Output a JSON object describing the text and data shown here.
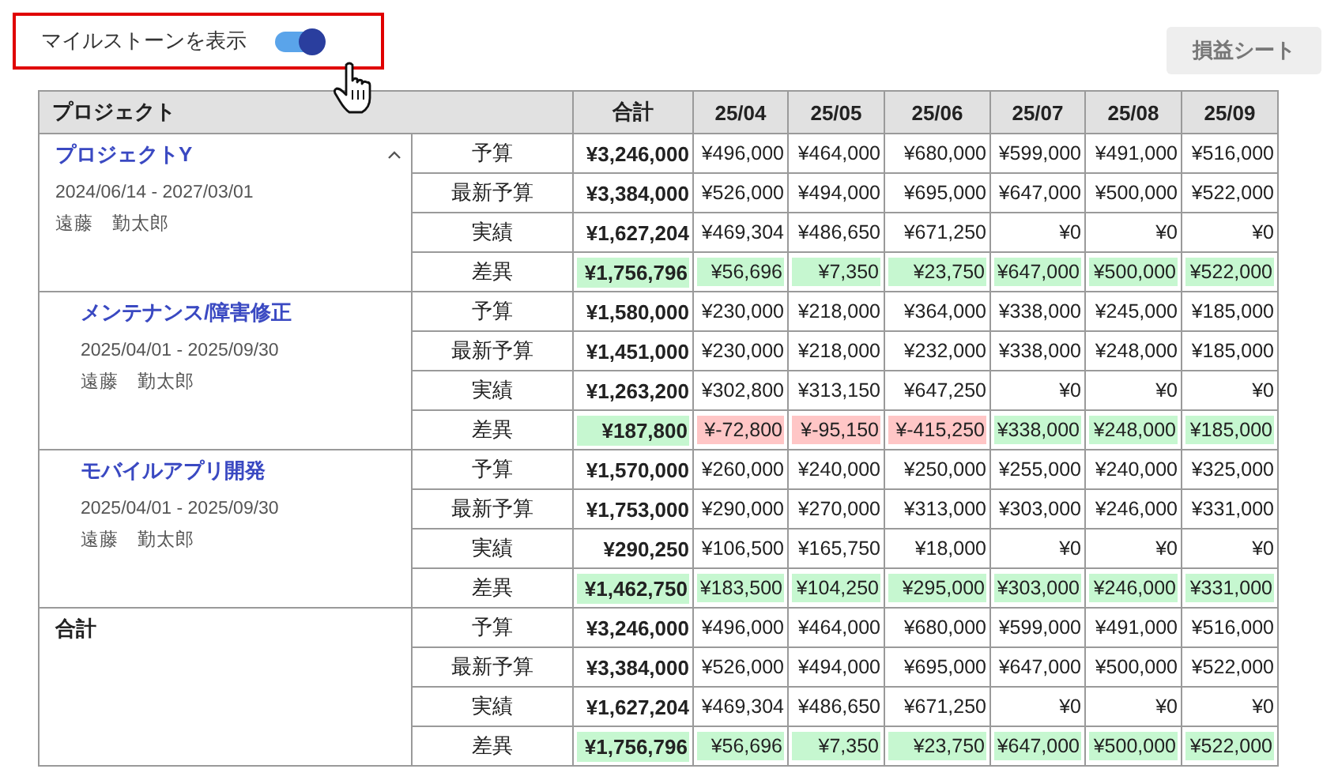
{
  "milestone_toggle": {
    "label": "マイルストーンを表示",
    "on": true
  },
  "pl_button": "損益シート",
  "table": {
    "columns": [
      "プロジェクト",
      "合計",
      "25/04",
      "25/05",
      "25/06",
      "25/07",
      "25/08",
      "25/09"
    ],
    "groups": [
      {
        "kind": "project",
        "name": "プロジェクトY",
        "expanded": true,
        "period": "2024/06/14 - 2027/03/01",
        "owner": "遠藤　勤太郎",
        "rows": [
          {
            "kind": "plain",
            "label": "予算",
            "total": "¥3,246,000",
            "values": [
              "¥496,000",
              "¥464,000",
              "¥680,000",
              "¥599,000",
              "¥491,000",
              "¥516,000"
            ]
          },
          {
            "kind": "plain",
            "label": "最新予算",
            "total": "¥3,384,000",
            "values": [
              "¥526,000",
              "¥494,000",
              "¥695,000",
              "¥647,000",
              "¥500,000",
              "¥522,000"
            ]
          },
          {
            "kind": "plain",
            "label": "実績",
            "total": "¥1,627,204",
            "values": [
              "¥469,304",
              "¥486,650",
              "¥671,250",
              "¥0",
              "¥0",
              "¥0"
            ]
          },
          {
            "kind": "variance",
            "label": "差異",
            "total": {
              "text": "¥1,756,796",
              "negative": false
            },
            "values": [
              {
                "text": "¥56,696",
                "negative": false
              },
              {
                "text": "¥7,350",
                "negative": false
              },
              {
                "text": "¥23,750",
                "negative": false
              },
              {
                "text": "¥647,000",
                "negative": false
              },
              {
                "text": "¥500,000",
                "negative": false
              },
              {
                "text": "¥522,000",
                "negative": false
              }
            ]
          }
        ]
      },
      {
        "kind": "subproject",
        "name": "メンテナンス/障害修正",
        "period": "2025/04/01 - 2025/09/30",
        "owner": "遠藤　勤太郎",
        "rows": [
          {
            "kind": "plain",
            "label": "予算",
            "total": "¥1,580,000",
            "values": [
              "¥230,000",
              "¥218,000",
              "¥364,000",
              "¥338,000",
              "¥245,000",
              "¥185,000"
            ]
          },
          {
            "kind": "plain",
            "label": "最新予算",
            "total": "¥1,451,000",
            "values": [
              "¥230,000",
              "¥218,000",
              "¥232,000",
              "¥338,000",
              "¥248,000",
              "¥185,000"
            ]
          },
          {
            "kind": "plain",
            "label": "実績",
            "total": "¥1,263,200",
            "values": [
              "¥302,800",
              "¥313,150",
              "¥647,250",
              "¥0",
              "¥0",
              "¥0"
            ]
          },
          {
            "kind": "variance",
            "label": "差異",
            "total": {
              "text": "¥187,800",
              "negative": false
            },
            "values": [
              {
                "text": "¥-72,800",
                "negative": true
              },
              {
                "text": "¥-95,150",
                "negative": true
              },
              {
                "text": "¥-415,250",
                "negative": true
              },
              {
                "text": "¥338,000",
                "negative": false
              },
              {
                "text": "¥248,000",
                "negative": false
              },
              {
                "text": "¥185,000",
                "negative": false
              }
            ]
          }
        ]
      },
      {
        "kind": "subproject",
        "name": "モバイルアプリ開発",
        "period": "2025/04/01 - 2025/09/30",
        "owner": "遠藤　勤太郎",
        "rows": [
          {
            "kind": "plain",
            "label": "予算",
            "total": "¥1,570,000",
            "values": [
              "¥260,000",
              "¥240,000",
              "¥250,000",
              "¥255,000",
              "¥240,000",
              "¥325,000"
            ]
          },
          {
            "kind": "plain",
            "label": "最新予算",
            "total": "¥1,753,000",
            "values": [
              "¥290,000",
              "¥270,000",
              "¥313,000",
              "¥303,000",
              "¥246,000",
              "¥331,000"
            ]
          },
          {
            "kind": "plain",
            "label": "実績",
            "total": "¥290,250",
            "values": [
              "¥106,500",
              "¥165,750",
              "¥18,000",
              "¥0",
              "¥0",
              "¥0"
            ]
          },
          {
            "kind": "variance",
            "label": "差異",
            "total": {
              "text": "¥1,462,750",
              "negative": false
            },
            "values": [
              {
                "text": "¥183,500",
                "negative": false
              },
              {
                "text": "¥104,250",
                "negative": false
              },
              {
                "text": "¥295,000",
                "negative": false
              },
              {
                "text": "¥303,000",
                "negative": false
              },
              {
                "text": "¥246,000",
                "negative": false
              },
              {
                "text": "¥331,000",
                "negative": false
              }
            ]
          }
        ]
      },
      {
        "kind": "total",
        "name": "合計",
        "rows": [
          {
            "kind": "plain",
            "label": "予算",
            "total": "¥3,246,000",
            "values": [
              "¥496,000",
              "¥464,000",
              "¥680,000",
              "¥599,000",
              "¥491,000",
              "¥516,000"
            ]
          },
          {
            "kind": "plain",
            "label": "最新予算",
            "total": "¥3,384,000",
            "values": [
              "¥526,000",
              "¥494,000",
              "¥695,000",
              "¥647,000",
              "¥500,000",
              "¥522,000"
            ]
          },
          {
            "kind": "plain",
            "label": "実績",
            "total": "¥1,627,204",
            "values": [
              "¥469,304",
              "¥486,650",
              "¥671,250",
              "¥0",
              "¥0",
              "¥0"
            ]
          },
          {
            "kind": "variance",
            "label": "差異",
            "total": {
              "text": "¥1,756,796",
              "negative": false
            },
            "values": [
              {
                "text": "¥56,696",
                "negative": false
              },
              {
                "text": "¥7,350",
                "negative": false
              },
              {
                "text": "¥23,750",
                "negative": false
              },
              {
                "text": "¥647,000",
                "negative": false
              },
              {
                "text": "¥500,000",
                "negative": false
              },
              {
                "text": "¥522,000",
                "negative": false
              }
            ]
          }
        ]
      }
    ]
  }
}
